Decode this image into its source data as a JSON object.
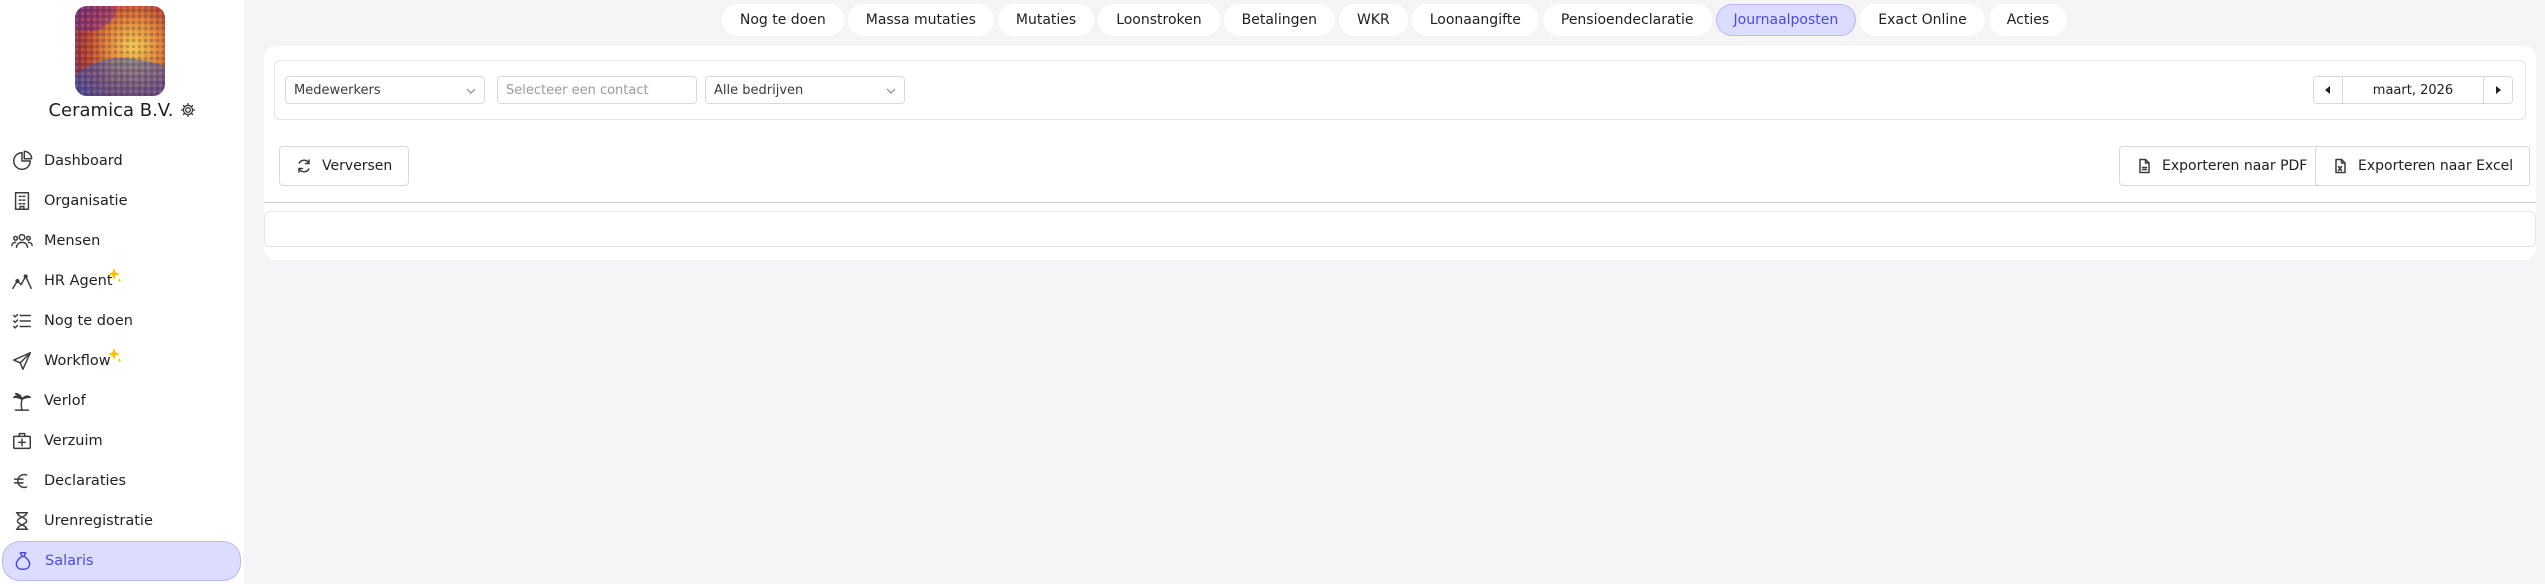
{
  "company": {
    "name": "Ceramica B.V."
  },
  "sidebar": {
    "items": [
      {
        "label": "Dashboard",
        "icon": "dashboard-icon"
      },
      {
        "label": "Organisatie",
        "icon": "building-icon"
      },
      {
        "label": "Mensen",
        "icon": "people-icon"
      },
      {
        "label": "HR Agent",
        "icon": "hr-agent-icon",
        "badge": "sparkle-icon"
      },
      {
        "label": "Nog te doen",
        "icon": "checklist-icon"
      },
      {
        "label": "Workflow",
        "icon": "paper-plane-icon",
        "badge": "sparkle-icon"
      },
      {
        "label": "Verlof",
        "icon": "palm-tree-icon"
      },
      {
        "label": "Verzuim",
        "icon": "medical-kit-icon"
      },
      {
        "label": "Declaraties",
        "icon": "euro-icon"
      },
      {
        "label": "Urenregistratie",
        "icon": "hourglass-icon"
      },
      {
        "label": "Salaris",
        "icon": "money-bag-icon",
        "active": true
      }
    ]
  },
  "tabs": [
    {
      "label": "Nog te doen"
    },
    {
      "label": "Massa mutaties"
    },
    {
      "label": "Mutaties"
    },
    {
      "label": "Loonstroken"
    },
    {
      "label": "Betalingen"
    },
    {
      "label": "WKR"
    },
    {
      "label": "Loonaangifte"
    },
    {
      "label": "Pensioendeclaratie"
    },
    {
      "label": "Journaalposten",
      "active": true
    },
    {
      "label": "Exact Online"
    },
    {
      "label": "Acties"
    }
  ],
  "filters": {
    "employees": "Medewerkers",
    "contact_placeholder": "Selecteer een contact",
    "companies": "Alle bedrijven"
  },
  "period": {
    "value": "maart, 2026"
  },
  "actions": {
    "refresh": "Verversen",
    "export_pdf": "Exporteren naar PDF",
    "export_excel": "Exporteren naar Excel"
  },
  "colors": {
    "accent": "#4b4be0",
    "accent_bg": "#dcdcff",
    "spark": "#f5c400"
  }
}
